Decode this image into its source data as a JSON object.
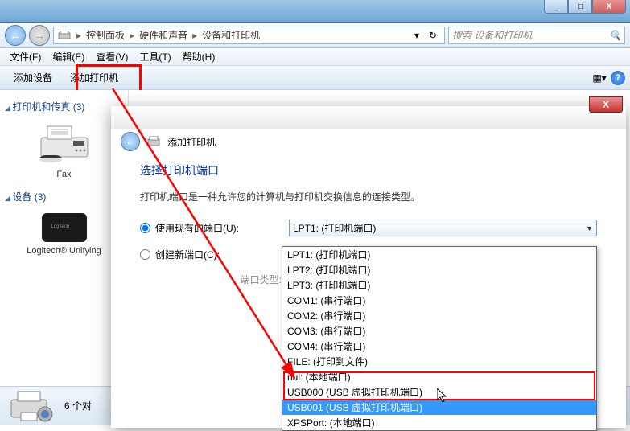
{
  "titlebar": {
    "min": "_",
    "max": "□",
    "close": "X"
  },
  "nav": {
    "back": "←",
    "fwd": "→",
    "crumbs": [
      "控制面板",
      "硬件和声音",
      "设备和打印机"
    ],
    "search_placeholder": "搜索 设备和打印机",
    "refresh": "↻",
    "dropdown": "▾"
  },
  "menu": [
    "文件(F)",
    "编辑(E)",
    "查看(V)",
    "工具(T)",
    "帮助(H)"
  ],
  "cmdbar": {
    "add_device": "添加设备",
    "add_printer": "添加打印机"
  },
  "sidebar": {
    "group1": {
      "title": "打印机和传真 (3)",
      "items": [
        {
          "label": "Fax"
        }
      ]
    },
    "group2": {
      "title": "设备 (3)",
      "items": [
        {
          "label": "Logitech® Unifying"
        }
      ]
    }
  },
  "statusbar": {
    "count": "6 个对"
  },
  "dialog": {
    "title_small": "添加打印机",
    "heading": "选择打印机端口",
    "desc": "打印机端口是一种允许您的计算机与打印机交换信息的连接类型。",
    "opt_existing": "使用现有的端口(U):",
    "opt_create": "创建新端口(C):",
    "port_type_label": "端口类型:",
    "combo_value": "LPT1: (打印机端口)",
    "close": "X"
  },
  "dropdown": {
    "items": [
      "LPT1: (打印机端口)",
      "LPT2: (打印机端口)",
      "LPT3: (打印机端口)",
      "COM1: (串行端口)",
      "COM2: (串行端口)",
      "COM3: (串行端口)",
      "COM4: (串行端口)",
      "FILE: (打印到文件)",
      "nul: (本地端口)",
      "USB000 (USB 虚拟打印机端口)",
      "USB001 (USB 虚拟打印机端口)",
      "XPSPort: (本地端口)"
    ],
    "selected_index": 10
  }
}
